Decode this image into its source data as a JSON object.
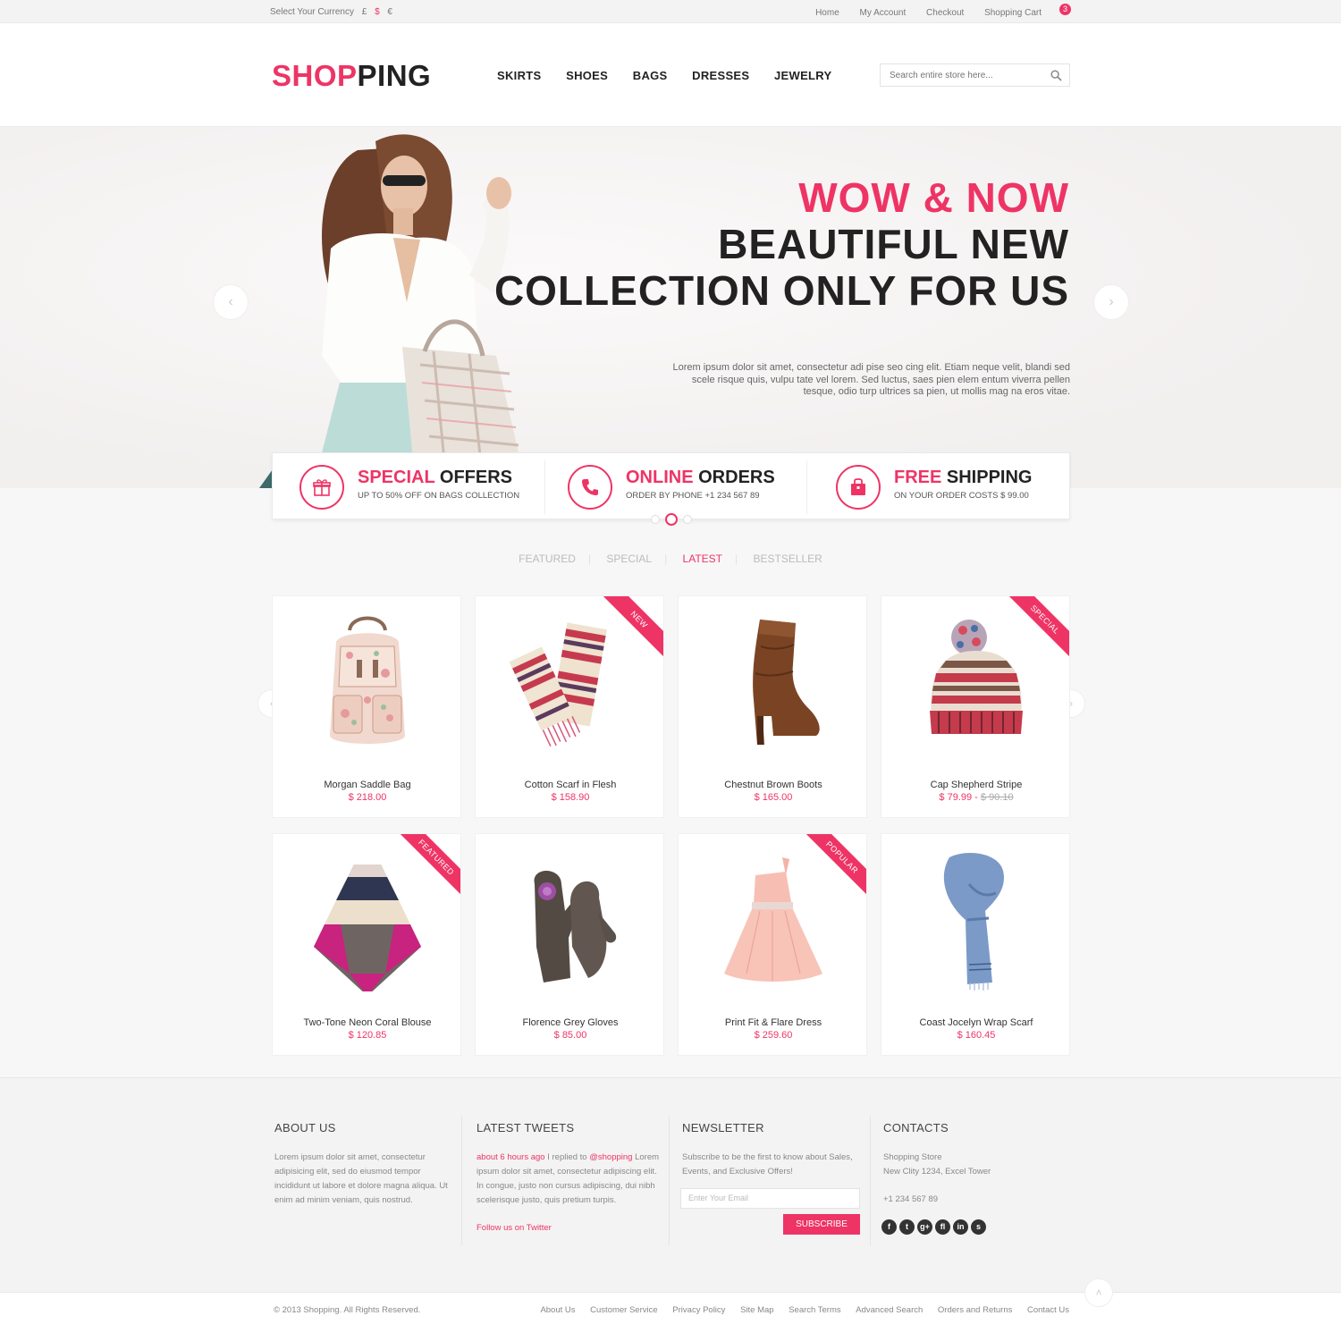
{
  "topbar": {
    "currency_label": "Select Your Currency",
    "currencies": [
      "£",
      "$",
      "€"
    ],
    "links": [
      "Home",
      "My Account",
      "Checkout",
      "Shopping Cart"
    ],
    "cart_count": "3"
  },
  "header": {
    "logo_part1": "SHOP",
    "logo_part2": "PING",
    "nav": [
      "SKIRTS",
      "SHOES",
      "BAGS",
      "DRESSES",
      "JEWELRY"
    ],
    "search_placeholder": "Search entire store here..."
  },
  "hero": {
    "line1": "WOW & NOW",
    "line2": "BEAUTIFUL NEW",
    "line3": "COLLECTION ONLY FOR US",
    "description": "Lorem ipsum dolor sit amet, consectetur adi pise seo cing elit. Etiam neque velit, blandi sed scele risque quis, vulpu tate vel lorem. Sed luctus, saes pien elem entum viverra pellen tesque, odio turp ultrices sa pien, ut mollis mag na eros vitae."
  },
  "features": [
    {
      "title_accent": "SPECIAL",
      "title_rest": " OFFERS",
      "subtitle": "UP TO 50% OFF ON BAGS COLLECTION",
      "icon": "gift-icon"
    },
    {
      "title_accent": "ONLINE",
      "title_rest": " ORDERS",
      "subtitle": "ORDER BY PHONE +1 234 567 89",
      "icon": "phone-icon"
    },
    {
      "title_accent": "FREE",
      "title_rest": " SHIPPING",
      "subtitle": "ON YOUR ORDER COSTS $ 99.00",
      "icon": "bag-icon"
    }
  ],
  "tabs": [
    "FEATURED",
    "SPECIAL",
    "LATEST",
    "BESTSELLER"
  ],
  "active_tab": "LATEST",
  "products": [
    {
      "name": "Morgan Saddle Bag",
      "price": "$ 218.00",
      "old_price": "",
      "ribbon": ""
    },
    {
      "name": "Cotton Scarf in Flesh",
      "price": "$ 158.90",
      "old_price": "",
      "ribbon": "NEW"
    },
    {
      "name": "Chestnut Brown Boots",
      "price": "$ 165.00",
      "old_price": "",
      "ribbon": ""
    },
    {
      "name": "Cap Shepherd Stripe",
      "price": "$ 79.99 - ",
      "old_price": "$ 90.10",
      "ribbon": "SPECIAL"
    },
    {
      "name": "Two-Tone Neon Coral Blouse",
      "price": "$ 120.85",
      "old_price": "",
      "ribbon": "FEATURED"
    },
    {
      "name": "Florence Grey Gloves",
      "price": "$ 85.00",
      "old_price": "",
      "ribbon": ""
    },
    {
      "name": "Print Fit & Flare Dress",
      "price": "$ 259.60",
      "old_price": "",
      "ribbon": "POPULAR"
    },
    {
      "name": "Coast Jocelyn Wrap Scarf",
      "price": "$ 160.45",
      "old_price": "",
      "ribbon": ""
    }
  ],
  "footer": {
    "about": {
      "title": "ABOUT US",
      "text": "Lorem ipsum dolor sit amet, consectetur adipisicing elit, sed do eiusmod tempor incididunt ut labore et dolore magna aliqua. Ut enim ad minim veniam, quis nostrud."
    },
    "tweets": {
      "title": "LATEST TWEETS",
      "time": "about 6 hours ago",
      "replied": " I replied to ",
      "handle": "@shopping",
      "text": " Lorem ipsum dolor sit amet, consectetur adipiscing elit. In congue, justo non cursus adipiscing, dui nibh scelerisque justo, quis pretium turpis.",
      "follow": "Follow us on Twitter"
    },
    "newsletter": {
      "title": "NEWSLETTER",
      "text": "Subscribe to be the first to know about Sales, Events, and Exclusive Offers!",
      "email_placeholder": "Enter Your Email",
      "button": "SUBSCRIBE"
    },
    "contacts": {
      "title": "CONTACTS",
      "store": "Shopping Store",
      "address": "New Clity 1234, Excel Tower",
      "phone": "+1 234 567 89",
      "social": [
        "f",
        "t",
        "g+",
        "fl",
        "in",
        "s"
      ]
    }
  },
  "bottom": {
    "copyright": "© 2013 Shopping. All Rights Reserved.",
    "links": [
      "About Us",
      "Customer Service",
      "Privacy Policy",
      "Site Map",
      "Search Terms",
      "Advanced Search",
      "Orders and Returns",
      "Contact Us"
    ]
  },
  "colors": {
    "accent": "#ee3465",
    "dark": "#222222"
  }
}
